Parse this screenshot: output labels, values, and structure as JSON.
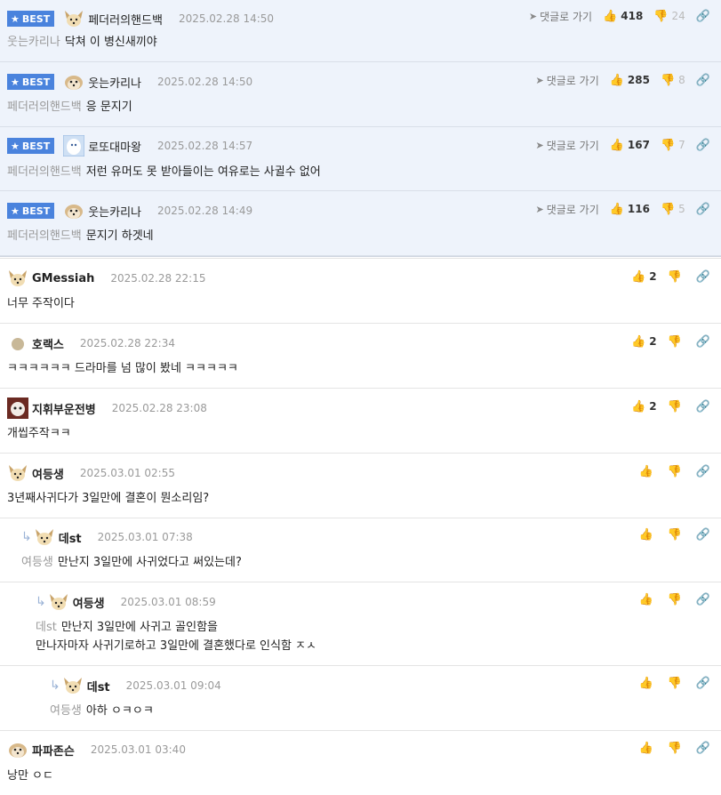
{
  "best_label": "BEST",
  "goto_label": "댓글로 가기",
  "best_comments": [
    {
      "nick": "페더러의핸드백",
      "date": "2025.02.28 14:50",
      "mention": "웃는카리나",
      "text": "닥쳐 이 병신새끼야",
      "up": "418",
      "down": "24"
    },
    {
      "nick": "웃는카리나",
      "date": "2025.02.28 14:50",
      "mention": "페더러의핸드백",
      "text": "응 문지기",
      "up": "285",
      "down": "8"
    },
    {
      "nick": "로또대마왕",
      "date": "2025.02.28 14:57",
      "mention": "페더러의핸드백",
      "text": "저런 유머도 못 받아들이는 여유로는 사귈수 없어",
      "up": "167",
      "down": "7"
    },
    {
      "nick": "웃는카리나",
      "date": "2025.02.28 14:49",
      "mention": "페더러의핸드백",
      "text": "문지기 하겟네",
      "up": "116",
      "down": "5"
    }
  ],
  "comments": [
    {
      "nick": "GMessiah",
      "date": "2025.02.28 22:15",
      "text": "너무 주작이다",
      "up": "2"
    },
    {
      "nick": "호랙스",
      "date": "2025.02.28 22:34",
      "text": "ㅋㅋㅋㅋㅋㅋ 드라마를 넘 많이 봤네 ㅋㅋㅋㅋㅋ",
      "up": "2"
    },
    {
      "nick": "지휘부운전병",
      "date": "2025.02.28 23:08",
      "text": "개씹주작ㅋㅋ",
      "up": "2"
    },
    {
      "nick": "여등생",
      "date": "2025.03.01 02:55",
      "text": "3년째사귀다가 3일만에 결혼이 뭔소리임?",
      "up": ""
    },
    {
      "nick": "데st",
      "date": "2025.03.01 07:38",
      "mention": "여등생",
      "text": "만난지 3일만에 사귀었다고 써있는데?",
      "up": ""
    },
    {
      "nick": "여등생",
      "date": "2025.03.01 08:59",
      "mention": "데st",
      "text": "만난지 3일만에 사귀고 골인함을",
      "text2": "만나자마자 사귀기로하고 3일만에 결혼했다로 인식함 ㅈㅅ",
      "up": ""
    },
    {
      "nick": "데st",
      "date": "2025.03.01 09:04",
      "mention": "여등생",
      "text": "아하 ㅇㅋㅇㅋ",
      "up": ""
    },
    {
      "nick": "파파존슨",
      "date": "2025.03.01 03:40",
      "text": "낭만 ㅇㄷ",
      "up": ""
    }
  ]
}
